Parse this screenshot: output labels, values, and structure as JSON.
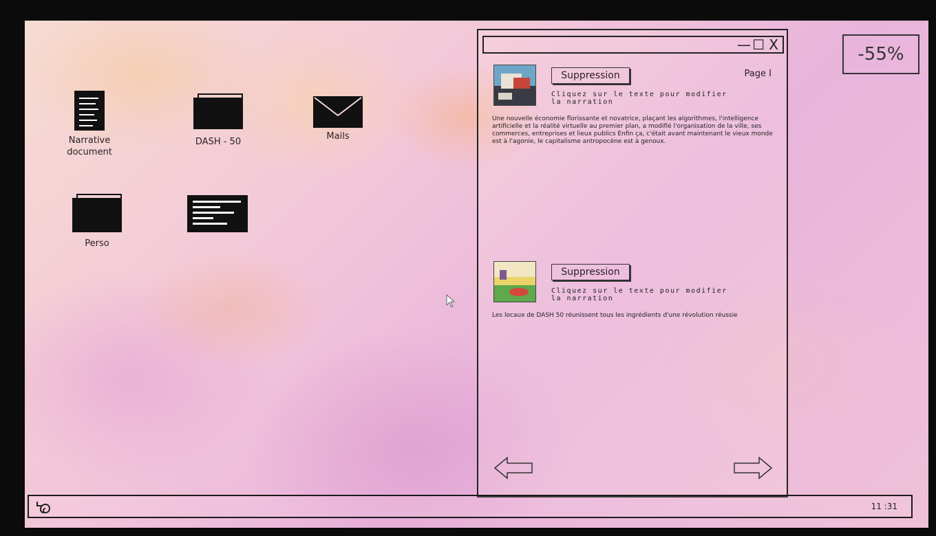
{
  "desktop": {
    "icons": [
      {
        "label": "Narrative\ndocument",
        "icon": "document-icon"
      },
      {
        "label": "DASH - 50",
        "icon": "folder-icon"
      },
      {
        "label": "Mails",
        "icon": "envelope-icon"
      },
      {
        "label": "Perso",
        "icon": "folder-icon"
      },
      {
        "label": "",
        "icon": "terminal-icon"
      }
    ]
  },
  "window": {
    "controls": {
      "minimize": "—",
      "maximize": "☐",
      "close": "X"
    },
    "page_label": "Page I",
    "posts": [
      {
        "button": "Suppression",
        "hint": "Cliquez sur le texte pour modifier\nla narration",
        "text": "Une nouvelle économie florissante et novatrice, plaçant les algorithmes, l'intelligence artificielle et la réalité virtuelle au premier plan, a modifié l'organisation de la ville, ses commerces, entreprises et lieux publics Enfin ça, c'était avant maintenant le vieux monde est à l'agonie, le capitalisme antropocène est à genoux."
      },
      {
        "button": "Suppression",
        "hint": "Cliquez sur le texte pour modifier\nla narration",
        "text": "Les locaux de DASH 50 réunissent tous les ingrédients d'une révolution réussie"
      }
    ],
    "nav": {
      "prev": "left-arrow-icon",
      "next": "right-arrow-icon"
    }
  },
  "battery": {
    "value": "-55%"
  },
  "taskbar": {
    "clock": "11 :31",
    "start_icon": "swirl-icon"
  }
}
